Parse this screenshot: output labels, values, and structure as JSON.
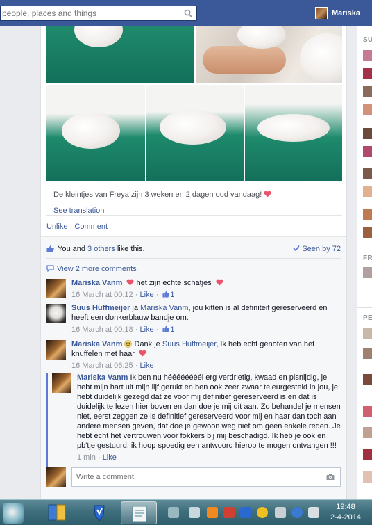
{
  "topbar": {
    "search_placeholder": "people, places and things",
    "user_name": "Mariska"
  },
  "post": {
    "caption": "De kleintjes van Freya zijn 3 weken en 2 dagen oud vandaag!",
    "see_translation": "See translation",
    "actions": {
      "unlike": "Unlike",
      "separator": "·",
      "comment": "Comment"
    }
  },
  "likes": {
    "you_and": "You and",
    "others": "3 others",
    "like_this": "like this.",
    "seen_by": "Seen by 72"
  },
  "view_more": "View 2 more comments",
  "comments": [
    {
      "name": "Mariska Vanm",
      "text": "het zijn echte schatjes",
      "time": "16 March at 00:12",
      "like": "Like",
      "likes_count": "1"
    },
    {
      "name": "Suus Huffmeijer",
      "text_pre": "ja",
      "mention": "Mariska Vanm",
      "text_post": ", jou kitten is al definiteif gereserveerd en heeft een donkerblauw bandje om.",
      "time": "16 March at 00:18",
      "like": "Like",
      "likes_count": "1"
    },
    {
      "name": "Mariska Vanm",
      "text_pre": "Dank je",
      "mention": "Suus Huffmeijer",
      "text_post": ", Ik heb echt genoten van het knuffelen met haar",
      "time": "16 March at 06:25",
      "like": "Like"
    },
    {
      "name": "Mariska Vanm",
      "text": "Ik ben nu héééééééél erg verdrietig, kwaad en pisnijdig, je hebt mijn hart uit mijn lijf gerukt en ben ook zeer zwaar teleurgesteld in jou, je hebt duidelijk gezegd dat ze voor mij definitief gereserveerd is en dat is duidelijk te lezen hier boven en dan doe je mij dit aan. Zo behandel je mensen niet, eerst zeggen ze is definitief gereserveerd voor mij en haar dan toch aan andere mensen geven, dat doe je gewoon weg niet om geen enkele reden. Je hebt echt het vertrouwen voor fokkers bij mij beschadigd. Ik heb je ook en pb'tje gestuurd, ik hoop spoedig een antwoord hierop te mogen ontvangen !!!",
      "time": "1 min",
      "like": "Like"
    }
  ],
  "write_comment_placeholder": "Write a comment...",
  "sidebar": {
    "labels": [
      "SU",
      "FR",
      "PE"
    ]
  },
  "taskbar": {
    "time": "19:48",
    "date": "2-4-2014"
  },
  "colors": {
    "brand_blue": "#3b5998",
    "heart_red": "#e9546b",
    "meta_gray": "#90949c"
  }
}
